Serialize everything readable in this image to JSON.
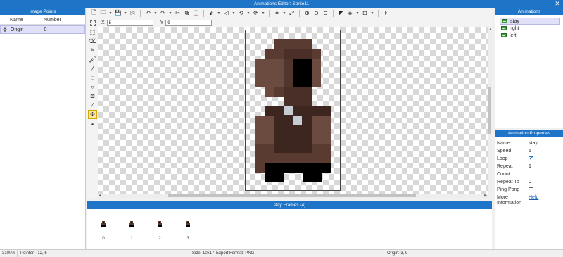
{
  "window": {
    "title": "Animations Editor: Sprite11",
    "close_glyph": "✕"
  },
  "image_points": {
    "title": "Image Points",
    "columns": [
      "Name",
      "Number"
    ],
    "rows": [
      {
        "name": "Origin",
        "number": "0"
      }
    ]
  },
  "toolbar": {
    "icons": [
      "new-icon",
      "open-icon",
      "save-icon",
      "export-icon",
      "undo-icon",
      "redo-icon",
      "cut-icon",
      "copy-icon",
      "paste-icon",
      "flip-h-icon",
      "flip-v-icon",
      "rotate-ccw-icon",
      "rotate-cw-icon",
      "crop-icon",
      "resize-icon",
      "zoom-in-icon",
      "zoom-out-icon",
      "zoom-fit-icon",
      "color-icon",
      "layers-icon",
      "grid-icon",
      "play-icon"
    ]
  },
  "selection": {
    "x_label": "X",
    "x_value": "5",
    "y_label": "Y",
    "y_value": "9"
  },
  "tools": [
    "select-tool",
    "eraser-tool",
    "pencil-tool",
    "brush-tool",
    "line-tool",
    "rectangle-tool",
    "ellipse-tool",
    "fill-tool",
    "eyedropper-tool",
    "image-point-tool",
    "anchor-tool"
  ],
  "frames": {
    "title": "stay Frames (4)",
    "numbers": [
      "0",
      "1",
      "2",
      "3"
    ]
  },
  "animations": {
    "title": "Animations",
    "items": [
      {
        "label": "stay",
        "selected": true
      },
      {
        "label": "right"
      },
      {
        "label": "left"
      }
    ]
  },
  "properties": {
    "title": "Animation Properties",
    "name_label": "Name",
    "name_value": "stay",
    "speed_label": "Speed",
    "speed_value": "5",
    "loop_label": "Loop",
    "loop_checked": true,
    "repeat_count_label": "Repeat Count",
    "repeat_count_value": "1",
    "repeat_to_label": "Repeat To",
    "repeat_to_value": "0",
    "ping_pong_label": "Ping Pong",
    "ping_pong_checked": false,
    "more_label_1": "More",
    "more_label_2": "Information",
    "help_link": "Help"
  },
  "status": {
    "zoom": "3100%",
    "pointer": "Pointer: -12, 6",
    "size": "Size: 10x17",
    "export_format": "Export Format: PNG",
    "origin": "Origin: 3, 9"
  },
  "colors": {
    "accent": "#1e74c6",
    "sprite_dark": "#3d2620",
    "sprite_mid": "#5a3b31",
    "sprite_light": "#6b4a3f",
    "sprite_black": "#000000",
    "sprite_gray": "#c6ccd2"
  }
}
